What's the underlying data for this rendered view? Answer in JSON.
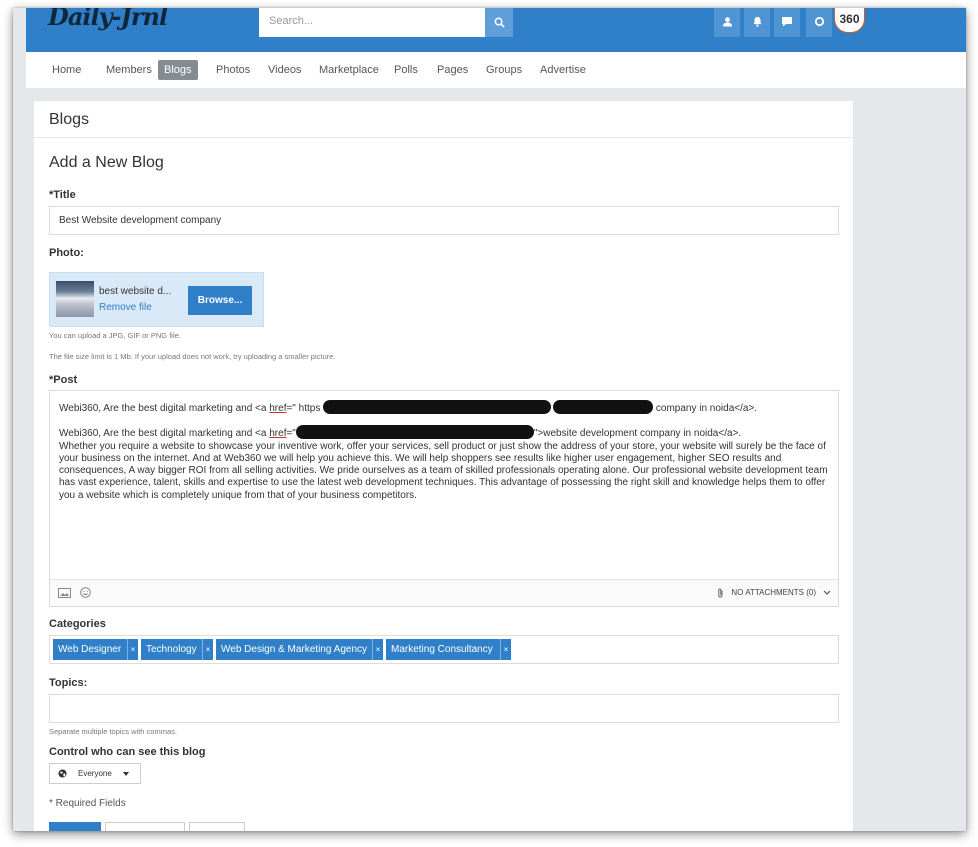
{
  "header": {
    "logo_text": "Daily-Jrnl",
    "search_placeholder": "Search...",
    "avatar_text": "360"
  },
  "nav": {
    "items": [
      "Home",
      "Members",
      "Blogs",
      "Photos",
      "Videos",
      "Marketplace",
      "Polls",
      "Pages",
      "Groups",
      "Advertise"
    ],
    "active": "Blogs"
  },
  "panel": {
    "title": "Blogs",
    "form_heading": "Add a New Blog"
  },
  "form": {
    "title_label": "*Title",
    "title_value": "Best Website development company",
    "photo_label": "Photo:",
    "file_name": "best website d...",
    "remove_file": "Remove file",
    "browse_label": "Browse...",
    "upload_help_1": "You can upload a JPG, GIF or PNG file.",
    "upload_help_2": "The file size limit is 1 Mb. If your upload does not work, try uploading a smaller picture.",
    "post_label": "*Post",
    "post_line1_a": "Webi360, Are the best digital marketing and <a ",
    "post_href": "href",
    "post_line1_b": "=\" https",
    "post_line1_c": "company in noida</a>.",
    "post_line2_a": "Webi360, Are the best digital marketing and <a ",
    "post_line2_b": "=\"",
    "post_line2_c": "\">website development company in noida</a>.",
    "post_paragraph": "Whether you require a website to showcase your inventive work, offer your services, sell product or just show the address of your store, your website will surely be the face of your business on the internet. And at Web360 we will help you achieve this. We will help shoppers see results like higher user engagement, higher SEO results and consequences, A way bigger ROI from all selling activities. We pride ourselves as a team of skilled professionals operating alone. Our professional website development team has vast experience, talent, skills and expertise to use the latest web development techniques. This advantage of possessing the right skill and knowledge helps them to offer you a website which is completely unique from that of your business competitors.",
    "attachments_label": "NO ATTACHMENTS (0)",
    "categories_label": "Categories",
    "categories": [
      "Web Designer",
      "Technology",
      "Web Design & Marketing Agency",
      "Marketing Consultancy"
    ],
    "tag_remove": "×",
    "topics_label": "Topics:",
    "topics_value": "",
    "topics_help": "Separate multiple topics with commas.",
    "privacy_label": "Control who can see this blog",
    "privacy_value": "Everyone",
    "required_note": "* Required Fields"
  },
  "icons": {
    "search": "search-icon",
    "notifications": "bell-icon",
    "messages": "chat-icon",
    "user": "user-icon",
    "image": "image-icon",
    "emoji": "emoji-icon",
    "attachment": "paperclip-icon",
    "globe": "globe-icon"
  },
  "colors": {
    "brand_blue": "#2f80c9",
    "nav_active": "#858b90",
    "page_bg": "#e4e8eb"
  }
}
